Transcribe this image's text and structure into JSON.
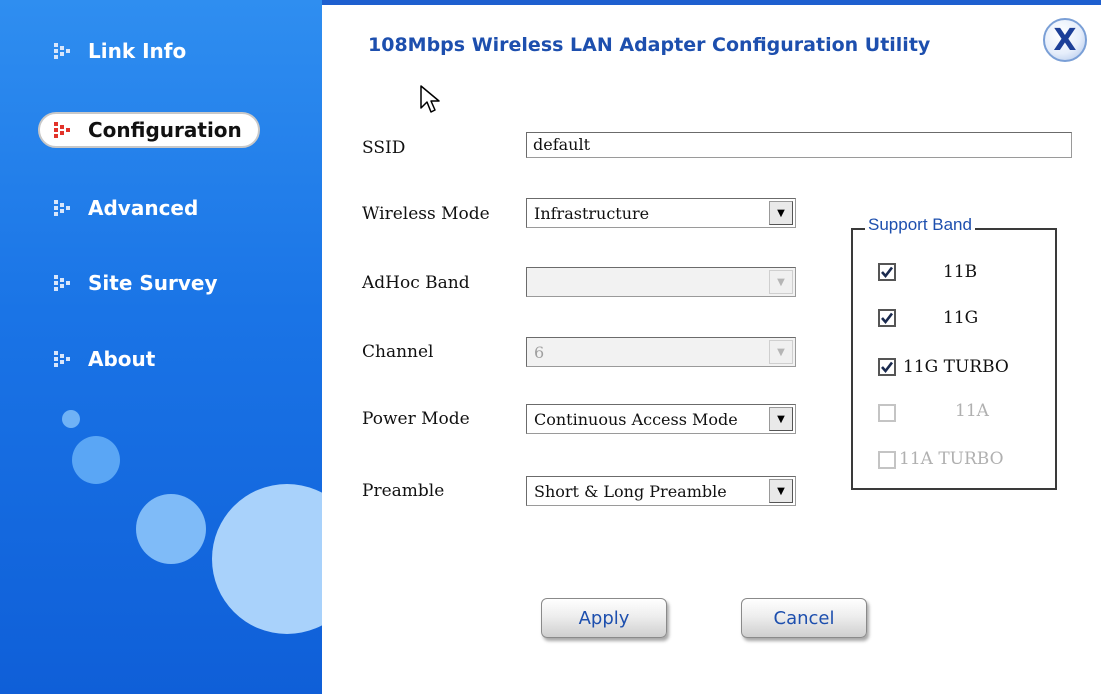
{
  "window": {
    "title": "108Mbps Wireless LAN Adapter Configuration Utility",
    "close_label": "X"
  },
  "sidebar": {
    "items": [
      {
        "label": "Link Info",
        "active": false
      },
      {
        "label": "Configuration",
        "active": true
      },
      {
        "label": "Advanced",
        "active": false
      },
      {
        "label": "Site Survey",
        "active": false
      },
      {
        "label": "About",
        "active": false
      }
    ]
  },
  "form": {
    "ssid": {
      "label": "SSID",
      "value": "default"
    },
    "wireless_mode": {
      "label": "Wireless Mode",
      "value": "Infrastructure"
    },
    "adhoc_band": {
      "label": "AdHoc Band",
      "value": "",
      "disabled": true
    },
    "channel": {
      "label": "Channel",
      "value": "6",
      "disabled": true
    },
    "power_mode": {
      "label": "Power Mode",
      "value": "Continuous Access Mode"
    },
    "preamble": {
      "label": "Preamble",
      "value": "Short & Long Preamble"
    }
  },
  "support_band": {
    "legend": "Support Band",
    "options": [
      {
        "label": "11B",
        "checked": true,
        "disabled": false
      },
      {
        "label": "11G",
        "checked": true,
        "disabled": false
      },
      {
        "label": "11G TURBO",
        "checked": true,
        "disabled": false
      },
      {
        "label": "11A",
        "checked": false,
        "disabled": true
      },
      {
        "label": "11A TURBO",
        "checked": false,
        "disabled": true
      }
    ]
  },
  "buttons": {
    "apply": "Apply",
    "cancel": "Cancel"
  },
  "colors": {
    "sidebar": "#1a74e6",
    "accent_text": "#1d4fae",
    "bullet_active": "#e2332a"
  }
}
